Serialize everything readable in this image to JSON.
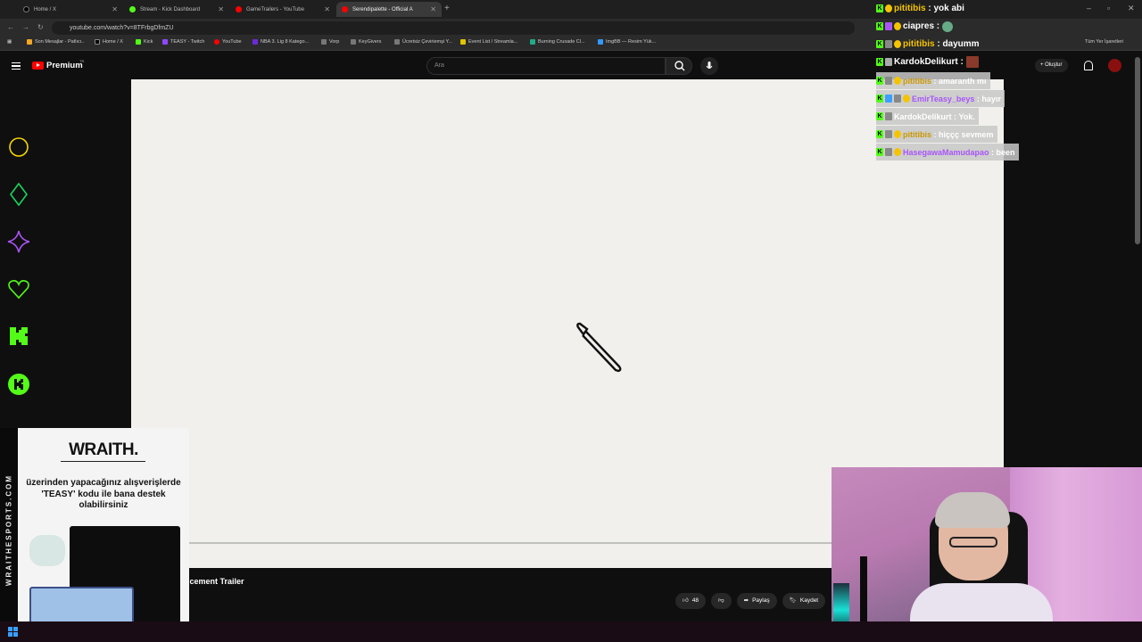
{
  "browser": {
    "tabs": [
      {
        "label": "Home / X",
        "color": "#000000"
      },
      {
        "label": "Stream - Kick Dashboard",
        "color": "#53fc18"
      },
      {
        "label": "GameTrailers - YouTube",
        "color": "#ff0000"
      },
      {
        "label": "Serendipalette - Official A",
        "color": "#ff0000"
      }
    ],
    "url": "youtube.com/watch?v=8TFrbgDfmZU",
    "bookmarks": [
      "Son Mesajlar - Patlıcı..",
      "Home / X",
      "Kick",
      "TEASY - Twitch",
      "YouTube",
      "NBA 3. Lig 8 Katego...",
      "Vorp",
      "KeyGivers",
      "Ücretsiz Çeviriemşi Y...",
      "Event List / Streamla...",
      "Burning Crusade Cl...",
      "ImgBB — Resim Yük..."
    ],
    "bookmarks_all": "Tüm Yer İşaretleri"
  },
  "youtube": {
    "logo": "Premium",
    "logo_region": "TR",
    "search_placeholder": "Ara",
    "create_label": "Oluştur",
    "video_title": "ncement Trailer",
    "likes": "48",
    "share_label": "Paylaş",
    "save_label": "Kaydet"
  },
  "sponsor": {
    "brand": "WRAITH.",
    "side_text": "WRAITHESPORTS.COM",
    "text": "üzerinden yapacağınız alışverişlerde 'TEASY' kodu ile bana destek olabilirsiniz"
  },
  "chat": [
    {
      "user": "pititibis",
      "message": "yok abi",
      "user_color": "#f5c400",
      "bg": false
    },
    {
      "user": "ciapres",
      "message": "",
      "user_color": "#ffffff",
      "bg": false
    },
    {
      "user": "pititibis",
      "message": "dayumm",
      "user_color": "#f5c400",
      "bg": false
    },
    {
      "user": "KardokDelikurt",
      "message": "",
      "user_color": "#ffffff",
      "bg": false
    },
    {
      "user": "pititibis",
      "message": "amaranth mı",
      "user_color": "#f5c400",
      "bg": true
    },
    {
      "user": "EmirTeasy_beys",
      "message": "hayır",
      "user_color": "#a855f7",
      "bg": true
    },
    {
      "user": "KardokDelikurt",
      "message": "Yok.",
      "user_color": "#ffffff",
      "bg": true
    },
    {
      "user": "pititibis",
      "message": "hiççç sevmem",
      "user_color": "#f5c400",
      "bg": true
    },
    {
      "user": "HasegawaMamudapao",
      "message": "been",
      "user_color": "#a855f7",
      "bg": true
    }
  ]
}
